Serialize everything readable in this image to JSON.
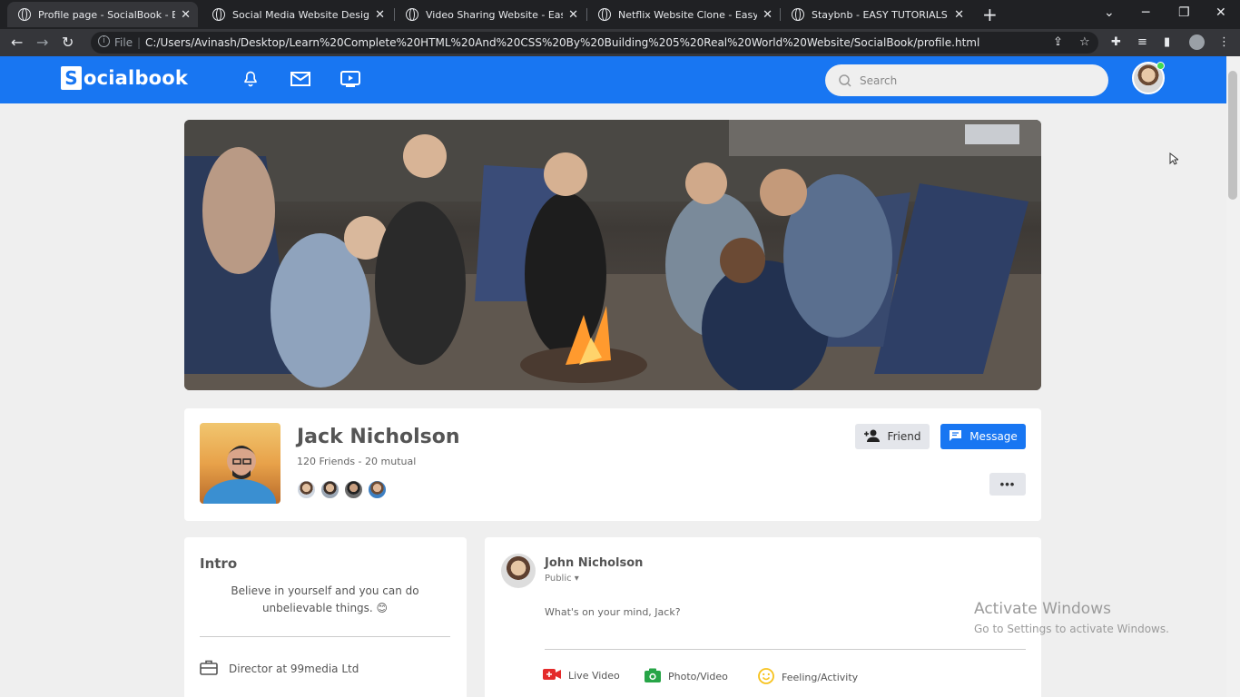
{
  "browser": {
    "tabs": [
      {
        "title": "Profile page - SocialBook - Easy",
        "active": true
      },
      {
        "title": "Social Media Website Design - E",
        "active": false
      },
      {
        "title": "Video Sharing Website - Easy Tu",
        "active": false
      },
      {
        "title": "Netflix Website Clone - Easy Tuto",
        "active": false
      },
      {
        "title": "Staybnb - EASY TUTORIALS",
        "active": false
      }
    ],
    "omnibox": {
      "scheme_label": "File",
      "separator": "|",
      "url": "C:/Users/Avinash/Desktop/Learn%20Complete%20HTML%20And%20CSS%20By%20Building%205%20Real%20World%20Website/SocialBook/profile.html"
    }
  },
  "site": {
    "logo_letter": "S",
    "logo_text": "ocialbook",
    "search_placeholder": "Search",
    "nav_icons": [
      "bell-icon",
      "mail-icon",
      "video-icon"
    ],
    "brand_color": "#1876f2"
  },
  "profile": {
    "name": "Jack Nicholson",
    "friends_text": "120 Friends - 20 mutual",
    "friend_button": "Friend",
    "message_button": "Message",
    "more_button": "•••"
  },
  "intro": {
    "title": "Intro",
    "bio": "Believe in yourself and you can do unbelievable things. 😊",
    "job": "Director at 99media Ltd"
  },
  "post": {
    "author": "John Nicholson",
    "privacy": "Public",
    "placeholder": "What's on your mind, Jack?",
    "actions": [
      "Live Video",
      "Photo/Video",
      "Feeling/Activity"
    ]
  },
  "watermark": {
    "line1": "Activate Windows",
    "line2": "Go to Settings to activate Windows."
  }
}
